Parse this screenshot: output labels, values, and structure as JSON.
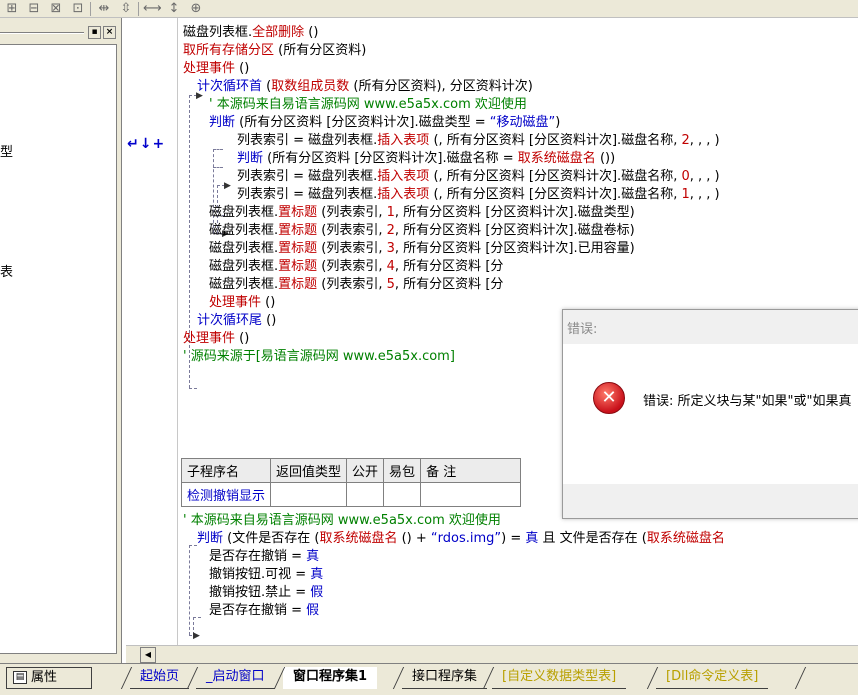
{
  "left_panel": {
    "items": [
      {
        "text": "型"
      },
      {
        "text": "表"
      }
    ]
  },
  "code_lines": [
    {
      "parts": [
        [
          "blk",
          "磁盘列表框."
        ],
        [
          "kw-red",
          "全部删除"
        ],
        [
          "blk",
          " ()"
        ]
      ]
    },
    {
      "parts": [
        [
          "kw-red",
          "取所有存储分区"
        ],
        [
          "blk",
          " (所有分区资料)"
        ]
      ]
    },
    {
      "parts": [
        [
          "kw-red",
          "处理事件"
        ],
        [
          "blk",
          " ()"
        ]
      ]
    },
    {
      "parts": [
        [
          "kw-blue",
          "计次循环首"
        ],
        [
          "blk",
          " ("
        ],
        [
          "kw-red",
          "取数组成员数"
        ],
        [
          "blk",
          " (所有分区资料), 分区资料计次)"
        ]
      ]
    },
    {
      "parts": [
        [
          "cmt",
          "' 本源码来自易语言源码网 www.e5a5x.com  欢迎使用"
        ]
      ]
    },
    {
      "parts": [
        [
          "kw-blue",
          "判断"
        ],
        [
          "blk",
          " (所有分区资料 [分区资料计次].磁盘类型 = "
        ],
        [
          "str",
          "“移动磁盘”"
        ],
        [
          "blk",
          ")"
        ]
      ]
    },
    {
      "parts": [
        [
          "blk",
          "列表索引 = 磁盘列表框."
        ],
        [
          "kw-red",
          "插入表项"
        ],
        [
          "blk",
          " (, 所有分区资料 [分区资料计次].磁盘名称, "
        ],
        [
          "num",
          "2"
        ],
        [
          "blk",
          ", , , )"
        ]
      ]
    },
    {
      "parts": [
        [
          "kw-blue",
          "判断"
        ],
        [
          "blk",
          " (所有分区资料 [分区资料计次].磁盘名称 = "
        ],
        [
          "kw-red",
          "取系统磁盘名"
        ],
        [
          "blk",
          " ())"
        ]
      ]
    },
    {
      "parts": [
        [
          "blk",
          "列表索引 = 磁盘列表框."
        ],
        [
          "kw-red",
          "插入表项"
        ],
        [
          "blk",
          " (, 所有分区资料 [分区资料计次].磁盘名称, "
        ],
        [
          "num",
          "0"
        ],
        [
          "blk",
          ", , , )"
        ]
      ]
    },
    {
      "parts": [
        [
          "blk",
          "列表索引 = 磁盘列表框."
        ],
        [
          "kw-red",
          "插入表项"
        ],
        [
          "blk",
          " (, 所有分区资料 [分区资料计次].磁盘名称, "
        ],
        [
          "num",
          "1"
        ],
        [
          "blk",
          ", , , )"
        ]
      ]
    },
    {
      "parts": [
        [
          "blk",
          "磁盘列表框."
        ],
        [
          "kw-red",
          "置标题"
        ],
        [
          "blk",
          " (列表索引, "
        ],
        [
          "num",
          "1"
        ],
        [
          "blk",
          ", 所有分区资料 [分区资料计次].磁盘类型)"
        ]
      ]
    },
    {
      "parts": [
        [
          "blk",
          "磁盘列表框."
        ],
        [
          "kw-red",
          "置标题"
        ],
        [
          "blk",
          " (列表索引, "
        ],
        [
          "num",
          "2"
        ],
        [
          "blk",
          ", 所有分区资料 [分区资料计次].磁盘卷标)"
        ]
      ]
    },
    {
      "parts": [
        [
          "blk",
          "磁盘列表框."
        ],
        [
          "kw-red",
          "置标题"
        ],
        [
          "blk",
          " (列表索引, "
        ],
        [
          "num",
          "3"
        ],
        [
          "blk",
          ", 所有分区资料 [分区资料计次].已用容量)"
        ]
      ]
    },
    {
      "parts": [
        [
          "blk",
          "磁盘列表框."
        ],
        [
          "kw-red",
          "置标题"
        ],
        [
          "blk",
          " (列表索引, "
        ],
        [
          "num",
          "4"
        ],
        [
          "blk",
          ", 所有分区资料 [分"
        ]
      ]
    },
    {
      "parts": [
        [
          "blk",
          "磁盘列表框."
        ],
        [
          "kw-red",
          "置标题"
        ],
        [
          "blk",
          " (列表索引, "
        ],
        [
          "num",
          "5"
        ],
        [
          "blk",
          ", 所有分区资料 [分"
        ]
      ]
    },
    {
      "parts": [
        [
          "kw-red",
          "处理事件"
        ],
        [
          "blk",
          " ()"
        ]
      ]
    },
    {
      "parts": [
        [
          "kw-blue",
          "计次循环尾"
        ],
        [
          "blk",
          " ()"
        ]
      ]
    },
    {
      "parts": [
        [
          "kw-red",
          "处理事件"
        ],
        [
          "blk",
          " ()"
        ]
      ]
    },
    {
      "parts": [
        [
          "cmt",
          "' 源码来源于[易语言源码网 www.e5a5x.com]"
        ]
      ]
    }
  ],
  "code_lines_after": [
    {
      "parts": [
        [
          "cmt",
          "' 本源码来自易语言源码网 www.e5a5x.com  欢迎使用"
        ]
      ]
    },
    {
      "parts": [
        [
          "kw-blue",
          "判断"
        ],
        [
          "blk",
          " (文件是否存在 ("
        ],
        [
          "kw-red",
          "取系统磁盘名"
        ],
        [
          "blk",
          " () + "
        ],
        [
          "str",
          "“rdos.img”"
        ],
        [
          "blk",
          ") = "
        ],
        [
          "kw-blue",
          "真"
        ],
        [
          "blk",
          " 且 文件是否存在 ("
        ],
        [
          "kw-red",
          "取系统磁盘名"
        ]
      ]
    },
    {
      "parts": [
        [
          "blk",
          "是否存在撤销 = "
        ],
        [
          "kw-blue",
          "真"
        ]
      ]
    },
    {
      "parts": [
        [
          "blk",
          "撤销按钮.可视 = "
        ],
        [
          "kw-blue",
          "真"
        ]
      ]
    },
    {
      "parts": [
        [
          "blk",
          "撤销按钮.禁止 = "
        ],
        [
          "kw-blue",
          "假"
        ]
      ]
    },
    {
      "parts": [
        [
          "blk",
          "是否存在撤销 = "
        ],
        [
          "kw-blue",
          "假"
        ]
      ]
    }
  ],
  "subroutine_table": {
    "headers": [
      "子程序名",
      "返回值类型",
      "公开",
      "易包",
      "备 注"
    ],
    "rows": [
      [
        "检测撤销显示",
        "",
        "",
        "",
        ""
      ]
    ]
  },
  "dialog": {
    "title": "错误:",
    "message": "错误: 所定义块与某\"如果\"或\"如果真"
  },
  "bottom_tabs": {
    "properties": "属性",
    "tabs": [
      {
        "label": "起始页",
        "style": "t-blue"
      },
      {
        "label": "_启动窗口",
        "style": "t-blue"
      },
      {
        "label": "窗口程序集1",
        "style": "active"
      },
      {
        "label": "接口程序集",
        "style": ""
      },
      {
        "label": "[自定义数据类型表]",
        "style": "t-yellow"
      },
      {
        "label": "[Dll命令定义表]",
        "style": "t-yellow"
      }
    ]
  },
  "gutter_mark": "↵↓+"
}
